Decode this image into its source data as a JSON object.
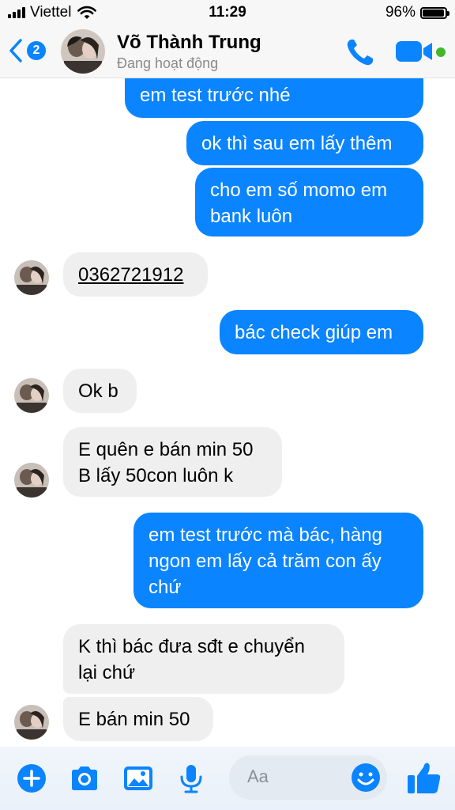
{
  "status_bar": {
    "carrier": "Viettel",
    "time": "11:29",
    "battery": "96%",
    "battery_level": 0.96
  },
  "header": {
    "unread_count": "2",
    "contact_name": "Võ Thành Trung",
    "contact_status": "Đang hoạt động"
  },
  "messages": [
    {
      "from": "me",
      "lines": [
        "em test trước nhé"
      ]
    },
    {
      "from": "me",
      "lines": [
        "ok thì sau em lấy thêm"
      ]
    },
    {
      "from": "me",
      "lines": [
        "cho em số momo em",
        "bank luôn"
      ]
    },
    {
      "from": "them",
      "lines": [
        "0362721912"
      ]
    },
    {
      "from": "me",
      "lines": [
        "bác check giúp em"
      ]
    },
    {
      "from": "them",
      "lines": [
        "Ok b"
      ]
    },
    {
      "from": "them",
      "lines": [
        "E quên e bán min 50",
        "B lấy 50con luôn k"
      ]
    },
    {
      "from": "me",
      "lines": [
        "em test trước mà bác, hàng",
        "ngon em lấy cả trăm con ấy",
        "chứ"
      ]
    },
    {
      "from": "them",
      "lines": [
        "K thì bác đưa sđt e chuyển",
        "lại chứ"
      ]
    },
    {
      "from": "them",
      "lines": [
        "E bán min 50"
      ]
    }
  ],
  "composer": {
    "placeholder": "Aa"
  },
  "colors": {
    "accent": "#0a84ff",
    "incoming_bubble": "#efefef",
    "online_dot": "#42b72a"
  }
}
